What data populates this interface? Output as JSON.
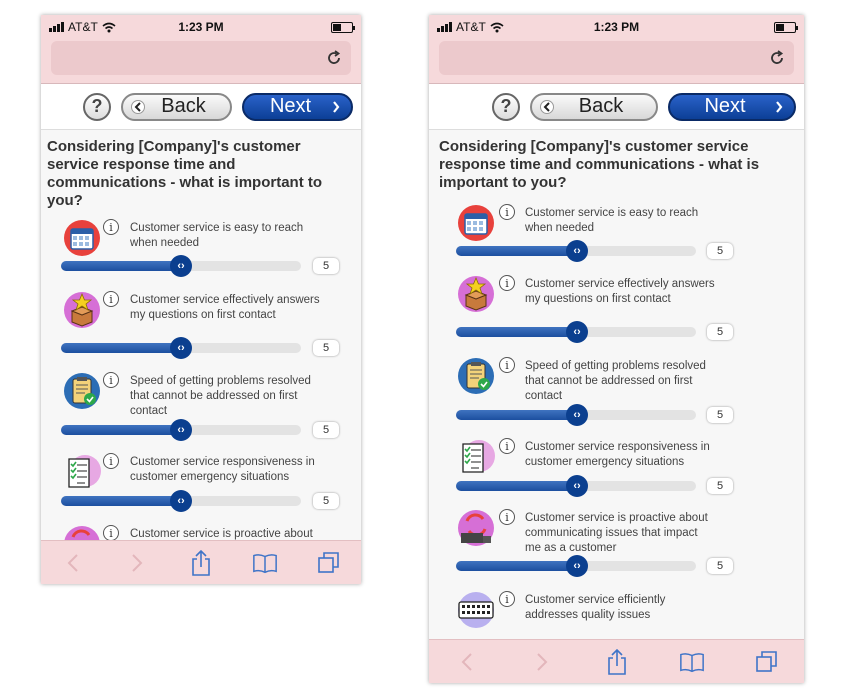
{
  "status": {
    "carrier": "AT&T",
    "time": "1:23 PM"
  },
  "nav": {
    "help_label": "?",
    "back_label": "Back",
    "next_label": "Next"
  },
  "question": "Considering [Company]'s customer service response time and communications - what is important to you?",
  "info_glyph": "i",
  "colors": {
    "chrome_pink": "#f6d9db",
    "accent_blue": "#0c3f96",
    "slider_fill": "#2a5fae"
  },
  "items": [
    {
      "text": "Customer service is easy to reach when needed",
      "value": "5",
      "level": 0.5,
      "icon": "calendar-icon"
    },
    {
      "text": "Customer service effectively answers my questions on first contact",
      "value": "5",
      "level": 0.5,
      "icon": "star-box-icon"
    },
    {
      "text": "Speed of getting problems resolved that cannot be addressed on first contact",
      "value": "5",
      "level": 0.5,
      "icon": "clipboard-check-icon"
    },
    {
      "text": "Customer service responsiveness in customer emergency situations",
      "value": "5",
      "level": 0.5,
      "icon": "checklist-icon"
    },
    {
      "text": "Customer service is proactive about communicating issues that impact me as a customer",
      "value": "5",
      "level": 0.5,
      "icon": "truck-arrows-icon"
    },
    {
      "text": "Customer service efficiently addresses quality issues",
      "value": "",
      "level": null,
      "icon": "keyboard-icon"
    }
  ]
}
